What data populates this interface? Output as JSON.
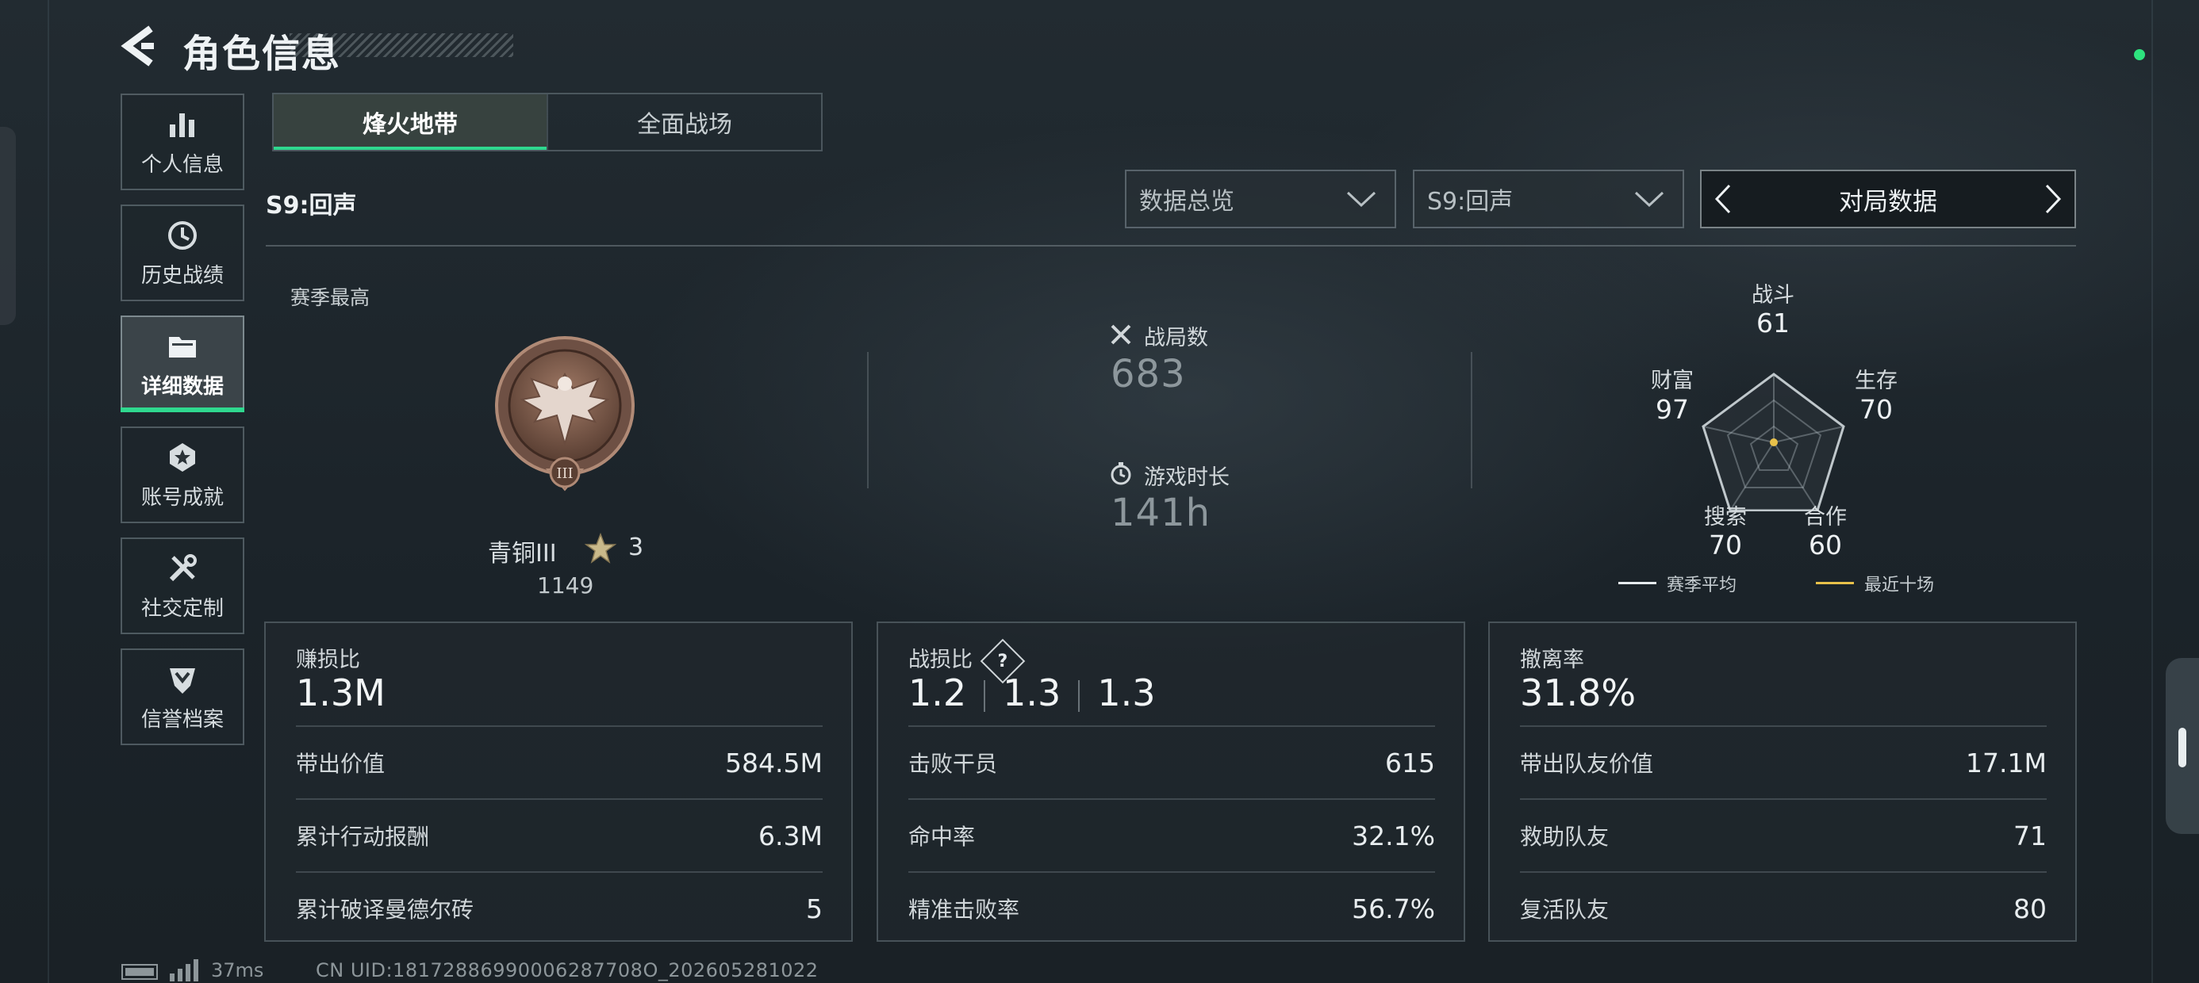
{
  "header": {
    "title": "角色信息"
  },
  "sidebar": {
    "items": [
      {
        "label": "个人信息",
        "icon": "bar-chart-icon"
      },
      {
        "label": "历史战绩",
        "icon": "history-clock-icon"
      },
      {
        "label": "详细数据",
        "icon": "folder-icon",
        "active": true
      },
      {
        "label": "账号成就",
        "icon": "achievement-badge-icon"
      },
      {
        "label": "社交定制",
        "icon": "tools-icon"
      },
      {
        "label": "信誉档案",
        "icon": "reputation-shield-icon"
      }
    ]
  },
  "tabs": [
    {
      "label": "烽火地带",
      "active": true
    },
    {
      "label": "全面战场",
      "active": false
    }
  ],
  "season_label": "S9:回声",
  "filters": {
    "overview": "数据总览",
    "season": "S9:回声"
  },
  "pager": {
    "label": "对局数据"
  },
  "season_best": {
    "label": "赛季最高",
    "rank_name": "青铜III",
    "stars": "3",
    "score": "1149"
  },
  "summary": {
    "matches_label": "战局数",
    "matches_value": "683",
    "playtime_label": "游戏时长",
    "playtime_value": "141h"
  },
  "radar": {
    "axes": [
      {
        "label": "战斗",
        "value": "61"
      },
      {
        "label": "生存",
        "value": "70"
      },
      {
        "label": "合作",
        "value": "60"
      },
      {
        "label": "搜索",
        "value": "70"
      },
      {
        "label": "财富",
        "value": "97"
      }
    ],
    "legend": [
      {
        "label": "赛季平均",
        "color": "#e6ebee"
      },
      {
        "label": "最近十场",
        "color": "#e8c14a"
      }
    ]
  },
  "cards": [
    {
      "title": "赚损比",
      "big": "1.3M",
      "rows": [
        {
          "k": "带出价值",
          "v": "584.5M"
        },
        {
          "k": "累计行动报酬",
          "v": "6.3M"
        },
        {
          "k": "累计破译曼德尔砖",
          "v": "5"
        }
      ]
    },
    {
      "title": "战损比",
      "help": "?",
      "big_parts": [
        "1.2",
        "1.3",
        "1.3"
      ],
      "rows": [
        {
          "k": "击败干员",
          "v": "615"
        },
        {
          "k": "命中率",
          "v": "32.1%"
        },
        {
          "k": "精准击败率",
          "v": "56.7%"
        }
      ]
    },
    {
      "title": "撤离率",
      "big": "31.8%",
      "rows": [
        {
          "k": "带出队友价值",
          "v": "17.1M"
        },
        {
          "k": "救助队友",
          "v": "71"
        },
        {
          "k": "复活队友",
          "v": "80"
        }
      ]
    }
  ],
  "footer": {
    "ping": "37ms",
    "uid": "CN UID:18172886990006287708O_202605281022"
  },
  "colors": {
    "accent": "#2fd88f",
    "status_online": "#2ee37e"
  }
}
